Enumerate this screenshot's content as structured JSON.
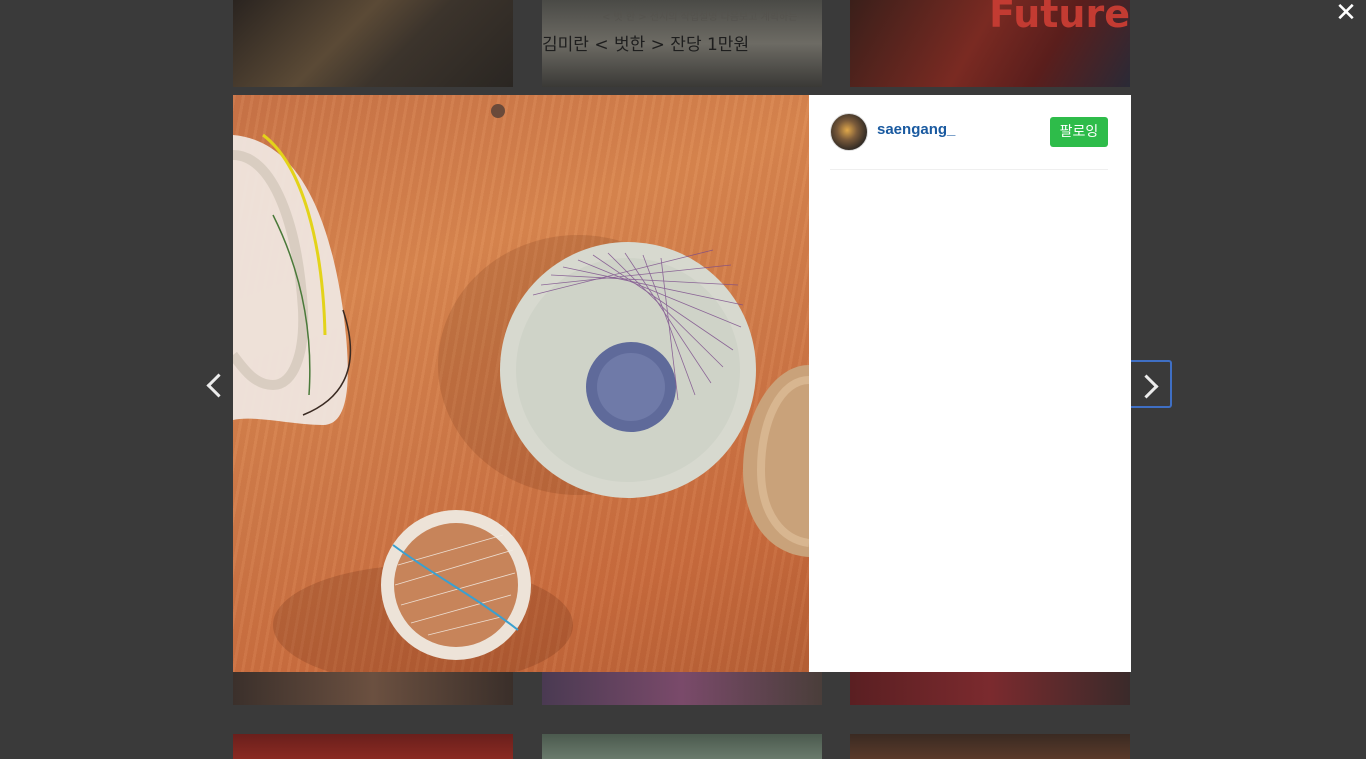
{
  "background_grid": {
    "row1": [
      {
        "caption": ""
      },
      {
        "caption_top": "< 벗 한 > 전시의 작업설명 다음보고 계획하는",
        "caption_bottom": "김미란 < 벗한 > 잔당 1만원"
      },
      {
        "caption": "Future"
      }
    ]
  },
  "close": {
    "label": "✕"
  },
  "post": {
    "username": "saengang_",
    "follow_label": "팔로잉"
  },
  "nav": {
    "prev": "previous",
    "next": "next"
  },
  "colors": {
    "follow": "#2ebc4a",
    "username": "#1a5aa0",
    "overlay": "#3a3a3a",
    "focus_ring": "#3f6fc4"
  }
}
